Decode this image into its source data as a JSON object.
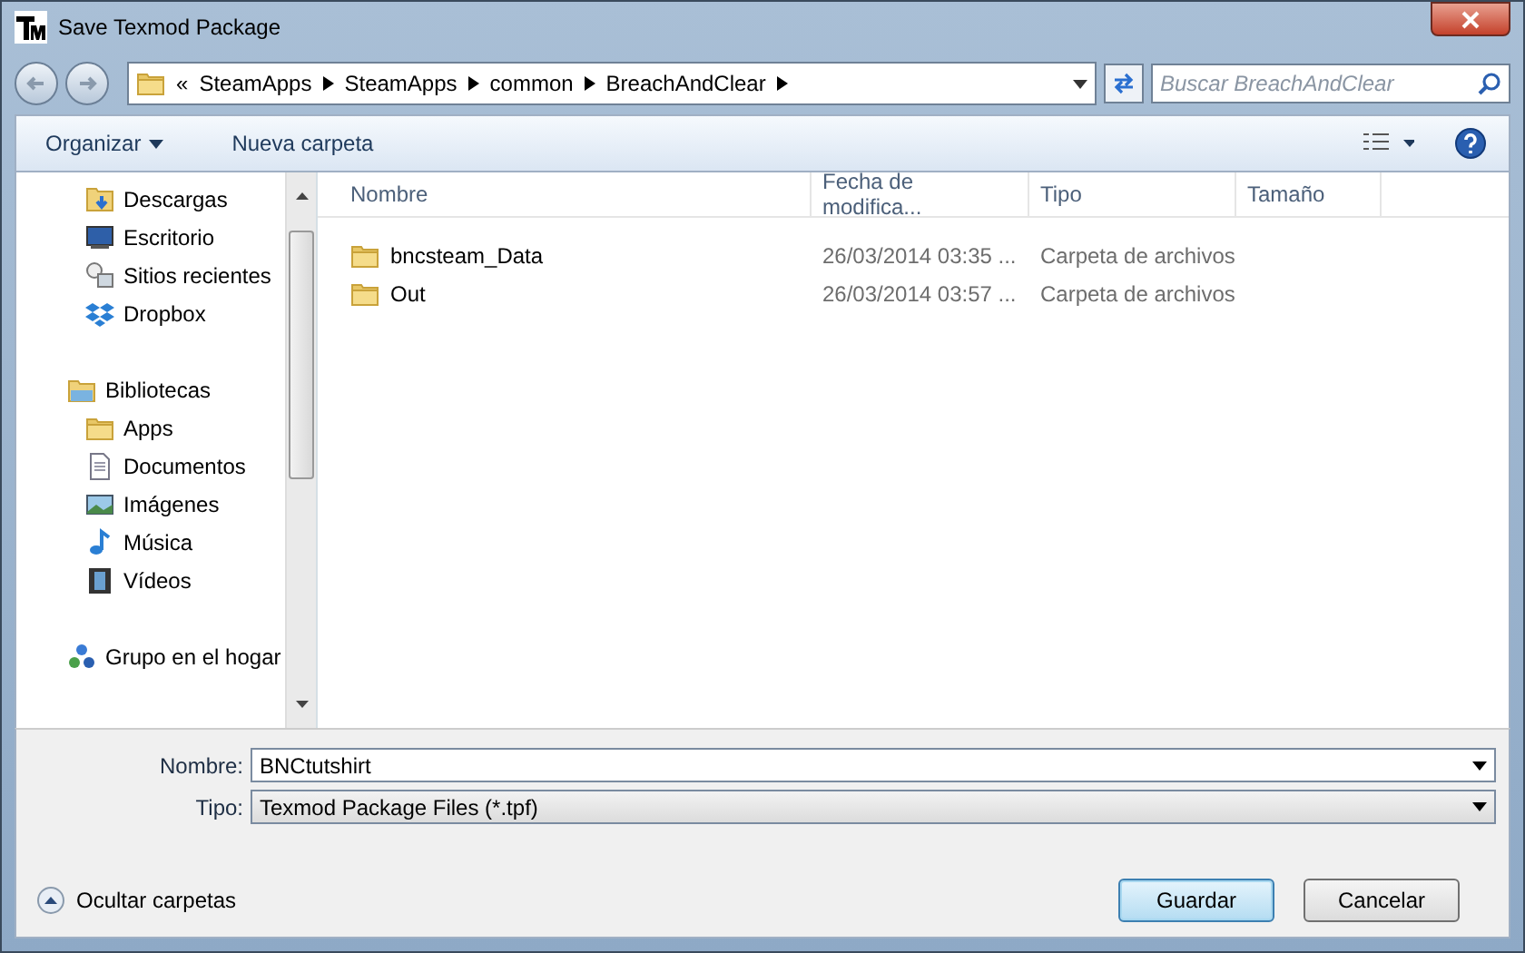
{
  "window": {
    "title": "Save Texmod Package"
  },
  "breadcrumb": {
    "overflow": "«",
    "segments": [
      "SteamApps",
      "SteamApps",
      "common",
      "BreachAndClear"
    ]
  },
  "search": {
    "placeholder": "Buscar BreachAndClear"
  },
  "toolbar": {
    "organize": "Organizar",
    "new_folder": "Nueva carpeta"
  },
  "sidebar": {
    "favorites": [
      {
        "label": "Descargas",
        "kind": "download"
      },
      {
        "label": "Escritorio",
        "kind": "desktop"
      },
      {
        "label": "Sitios recientes",
        "kind": "recent"
      },
      {
        "label": "Dropbox",
        "kind": "dropbox"
      }
    ],
    "items": [
      {
        "label": "Bibliotecas",
        "kind": "library",
        "children": [
          {
            "label": "Apps",
            "kind": "folder"
          },
          {
            "label": "Documentos",
            "kind": "document"
          },
          {
            "label": "Imágenes",
            "kind": "pictures"
          },
          {
            "label": "Música",
            "kind": "music"
          },
          {
            "label": "Vídeos",
            "kind": "video"
          }
        ]
      },
      {
        "label": "Grupo en el hogar",
        "kind": "homegroup"
      }
    ]
  },
  "table": {
    "columns": [
      "Nombre",
      "Fecha de modifica...",
      "Tipo",
      "Tamaño"
    ],
    "rows": [
      {
        "name": "bncsteam_Data",
        "date": "26/03/2014 03:35 ...",
        "type": "Carpeta de archivos"
      },
      {
        "name": "Out",
        "date": "26/03/2014 03:57 ...",
        "type": "Carpeta de archivos"
      }
    ]
  },
  "form": {
    "name_label": "Nombre:",
    "name_value": "BNCtutshirt",
    "type_label": "Tipo:",
    "type_value": "Texmod Package Files (*.tpf)"
  },
  "hide_folders": "Ocultar carpetas",
  "buttons": [
    {
      "label": "Guardar",
      "kind": "default"
    },
    {
      "label": "Cancelar",
      "kind": "normal"
    }
  ]
}
